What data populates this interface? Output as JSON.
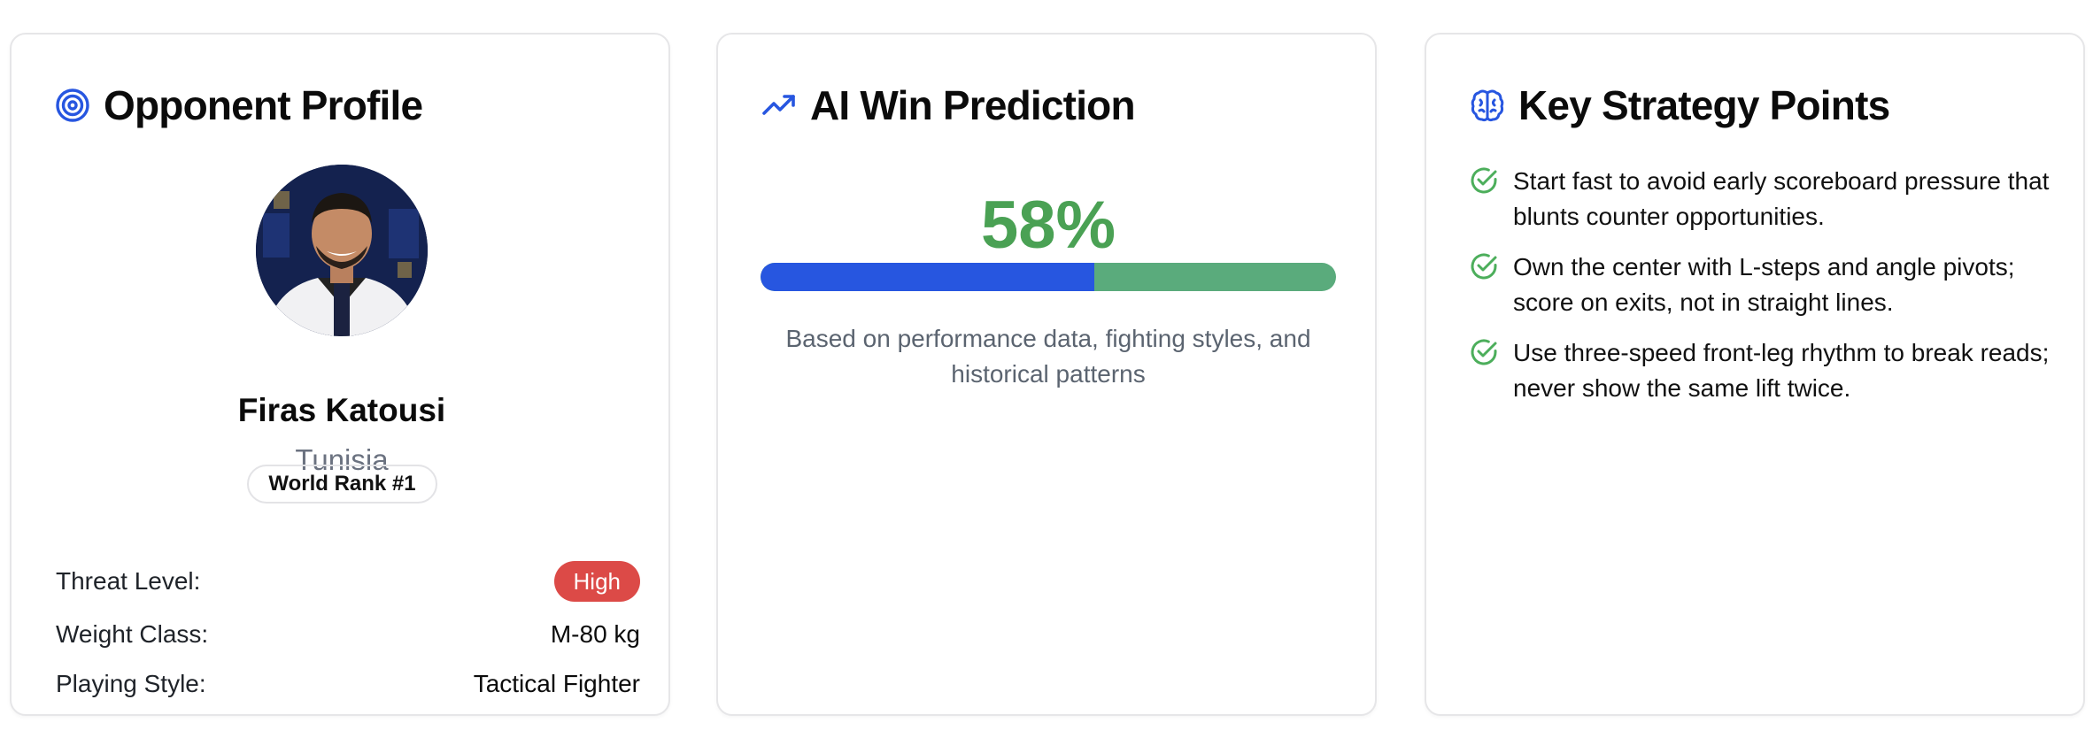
{
  "colors": {
    "accent_blue": "#2756e0",
    "win_green": "#4aa154",
    "bar_remainder": "#5aab7c",
    "threat_red": "#dc4a47",
    "check_green": "#4cae5b"
  },
  "profile": {
    "title": "Opponent Profile",
    "icon": "target-icon",
    "name": "Firas Katousi",
    "country": "Tunisia",
    "rank": "World Rank #1",
    "stats": [
      {
        "label": "Threat Level:",
        "value": "High"
      },
      {
        "label": "Weight Class:",
        "value": "M-80 kg"
      },
      {
        "label": "Playing Style:",
        "value": "Tactical Fighter"
      }
    ]
  },
  "prediction": {
    "title": "AI Win Prediction",
    "icon": "trending-up-icon",
    "percent_text": "58%",
    "progress_fraction": 0.58,
    "note": "Based on performance data, fighting styles, and historical patterns"
  },
  "strategy": {
    "title": "Key Strategy Points",
    "icon": "brain-icon",
    "points": [
      "Start fast to avoid early scoreboard pressure that blunts counter opportunities.",
      "Own the center with L-steps and angle pivots; score on exits, not in straight lines.",
      "Use three-speed front-leg rhythm to break reads; never show the same lift twice."
    ]
  }
}
